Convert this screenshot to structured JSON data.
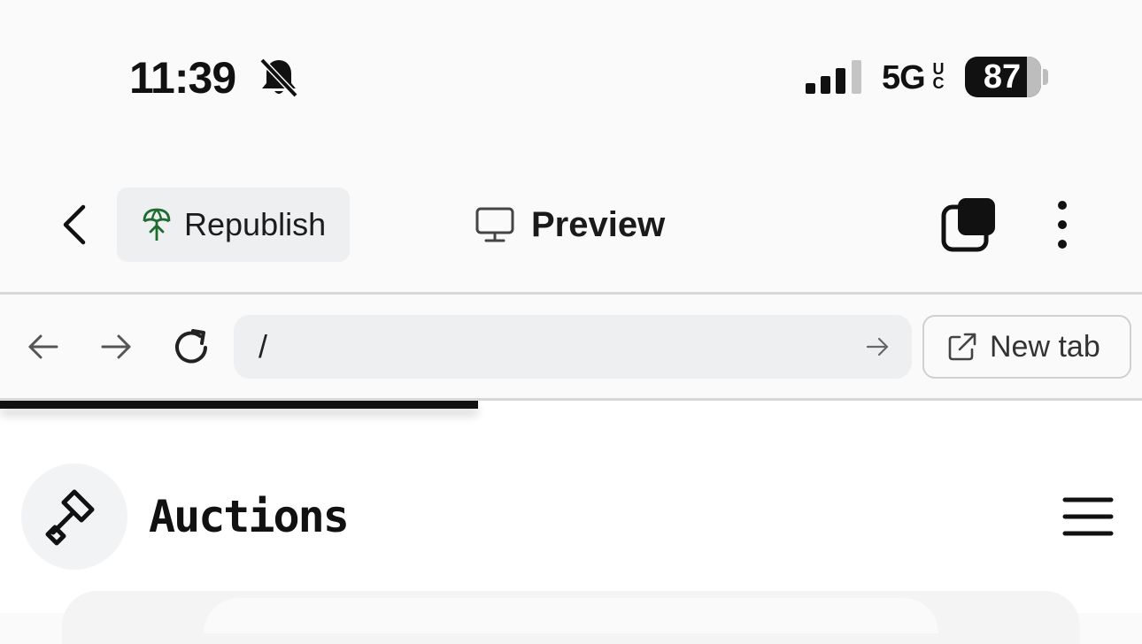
{
  "status_bar": {
    "time": "11:39",
    "network": "5G",
    "network_badge": "UC",
    "battery": "87",
    "icons": [
      "bell-slash-icon",
      "signal-icon"
    ]
  },
  "toolbar": {
    "back_icon": "chevron-left-icon",
    "republish_label": "Republish",
    "republish_icon": "parachute-icon",
    "preview_label": "Preview",
    "preview_icon": "monitor-icon",
    "tabs_icon": "tabs-icon",
    "more_icon": "more-vertical-icon"
  },
  "browser": {
    "url": "/",
    "new_tab_label": "New tab"
  },
  "site": {
    "title": "Auctions",
    "logo_icon": "gavel-icon",
    "menu_icon": "hamburger-menu-icon"
  },
  "colors": {
    "republish_icon": "#1e6b2e",
    "chrome_bg": "#fafafa",
    "pill_bg": "#eeeff1"
  }
}
